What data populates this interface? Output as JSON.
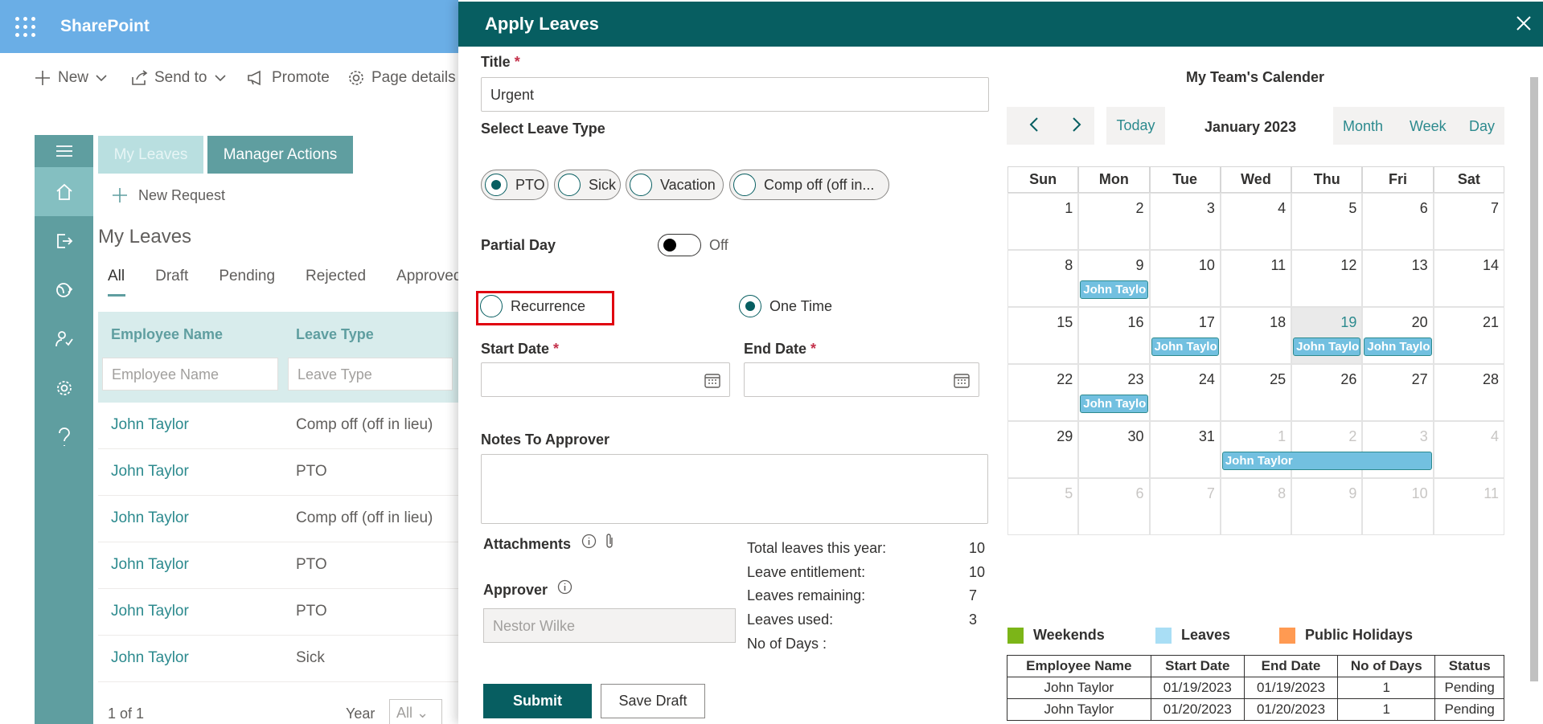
{
  "app": {
    "name": "SharePoint",
    "icons": [
      "waffle-icon"
    ]
  },
  "command_bar": {
    "new_label": "New",
    "send_to_label": "Send to",
    "promote_label": "Promote",
    "page_details_label": "Page details"
  },
  "tabs": {
    "my_leaves": "My Leaves",
    "manager_actions": "Manager Actions"
  },
  "list": {
    "new_request": "New Request",
    "heading": "My Leaves",
    "pivots": [
      "All",
      "Draft",
      "Pending",
      "Rejected",
      "Approved"
    ],
    "columns": {
      "employee": "Employee Name",
      "leave_type": "Leave Type"
    },
    "filters": {
      "employee_placeholder": "Employee Name",
      "leave_type_placeholder": "Leave Type"
    },
    "rows": [
      {
        "employee": "John Taylor",
        "leave_type": "Comp off (off in lieu)"
      },
      {
        "employee": "John Taylor",
        "leave_type": "PTO"
      },
      {
        "employee": "John Taylor",
        "leave_type": "Comp off (off in lieu)"
      },
      {
        "employee": "John Taylor",
        "leave_type": "PTO"
      },
      {
        "employee": "John Taylor",
        "leave_type": "PTO"
      },
      {
        "employee": "John Taylor",
        "leave_type": "Sick"
      }
    ],
    "pager": "1 of 1",
    "year_label": "Year",
    "year_value": "All"
  },
  "panel": {
    "title": "Apply Leaves",
    "title_label": "Title",
    "title_value": "Urgent",
    "leave_type_label": "Select Leave Type",
    "leave_types": [
      "PTO",
      "Sick",
      "Vacation",
      "Comp off (off in..."
    ],
    "selected_leave_type": "PTO",
    "partial_day_label": "Partial Day",
    "partial_day_state": "Off",
    "recurrence_label": "Recurrence",
    "one_time_label": "One Time",
    "start_date_label": "Start Date",
    "end_date_label": "End Date",
    "notes_label": "Notes To Approver",
    "attachments_label": "Attachments",
    "approver_label": "Approver",
    "approver_value": "Nestor Wilke",
    "stats": [
      {
        "label": "Total leaves this year:",
        "value": "10"
      },
      {
        "label": "Leave entitlement:",
        "value": "10"
      },
      {
        "label": "Leaves remaining:",
        "value": "7"
      },
      {
        "label": "Leaves used:",
        "value": "3"
      },
      {
        "label": "No of Days :",
        "value": ""
      }
    ],
    "submit_label": "Submit",
    "save_draft_label": "Save Draft"
  },
  "calendar": {
    "title": "My Team's Calender",
    "today_label": "Today",
    "month_label": "January 2023",
    "views": [
      "Month",
      "Week",
      "Day"
    ],
    "weekdays": [
      "Sun",
      "Mon",
      "Tue",
      "Wed",
      "Thu",
      "Fri",
      "Sat"
    ],
    "weeks": [
      [
        "1",
        "2",
        "3",
        "4",
        "5",
        "6",
        "7"
      ],
      [
        "8",
        "9",
        "10",
        "11",
        "12",
        "13",
        "14"
      ],
      [
        "15",
        "16",
        "17",
        "18",
        "19",
        "20",
        "21"
      ],
      [
        "22",
        "23",
        "24",
        "25",
        "26",
        "27",
        "28"
      ],
      [
        "29",
        "30",
        "31",
        "1",
        "2",
        "3",
        "4"
      ],
      [
        "5",
        "6",
        "7",
        "8",
        "9",
        "10",
        "11"
      ]
    ],
    "today_day": "19",
    "events": [
      {
        "label": "John Taylo",
        "week": 1,
        "day": 1,
        "span": 1
      },
      {
        "label": "John Taylo",
        "week": 2,
        "day": 2,
        "span": 1
      },
      {
        "label": "John Taylo",
        "week": 2,
        "day": 4,
        "span": 1
      },
      {
        "label": "John Taylo",
        "week": 2,
        "day": 5,
        "span": 1
      },
      {
        "label": "John Taylo",
        "week": 3,
        "day": 1,
        "span": 1
      },
      {
        "label": "John Taylor",
        "week": 4,
        "day": 3,
        "span": 3
      }
    ],
    "legend": [
      {
        "label": "Weekends",
        "color": "#7cb518"
      },
      {
        "label": "Leaves",
        "color": "#a9def5"
      },
      {
        "label": "Public Holidays",
        "color": "#ff9a52"
      }
    ],
    "table": {
      "headers": [
        "Employee Name",
        "Start Date",
        "End Date",
        "No of Days",
        "Status"
      ],
      "rows": [
        [
          "John Taylor",
          "01/19/2023",
          "01/19/2023",
          "1",
          "Pending"
        ],
        [
          "John Taylor",
          "01/20/2023",
          "01/20/2023",
          "1",
          "Pending"
        ]
      ]
    }
  },
  "colors": {
    "brand": "#075e61",
    "accent": "#2c8a8e",
    "suite_bar": "#6aaee6",
    "highlight": "#e0000f"
  }
}
